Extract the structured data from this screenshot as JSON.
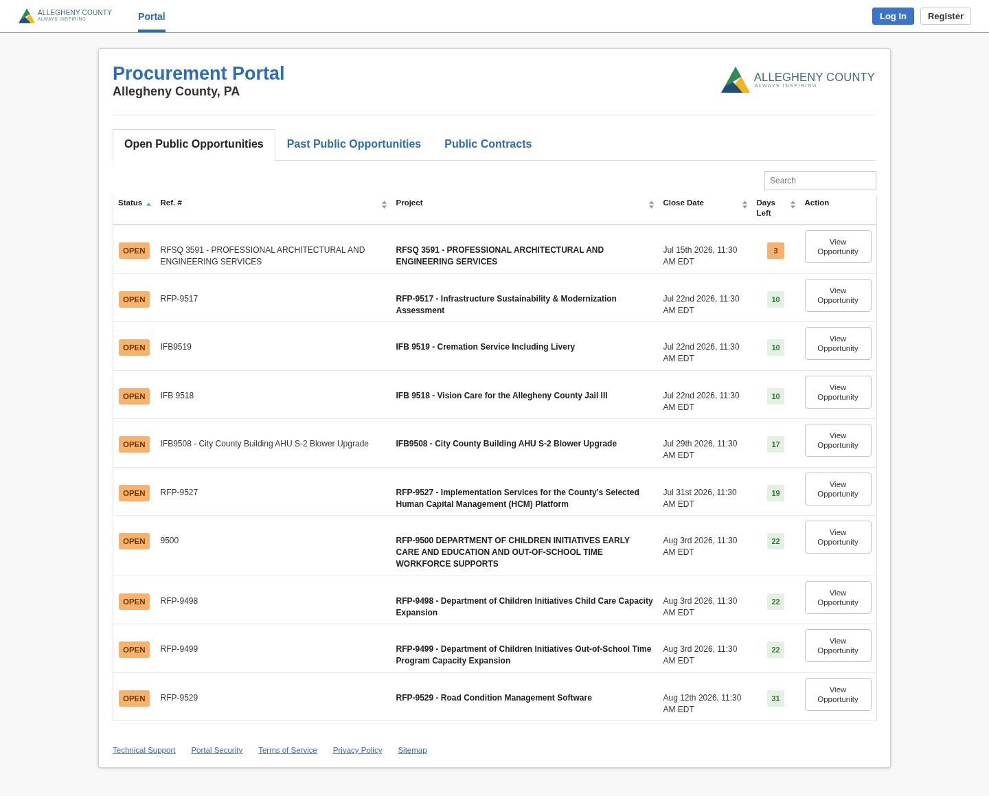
{
  "top_bar": {
    "logo": {
      "name": "ALLEGHENY COUNTY",
      "tagline": "ALWAYS INSPIRING"
    },
    "nav": [
      {
        "label": "Portal",
        "selected": true
      }
    ],
    "buttons": [
      {
        "label": "Log In",
        "kind": "primary"
      },
      {
        "label": "Register",
        "kind": "secondary"
      }
    ]
  },
  "header": {
    "title": "Procurement Portal",
    "subtitle": "Allegheny County, PA",
    "logo": {
      "name": "ALLEGHENY COUNTY",
      "tagline": "ALWAYS INSPIRING"
    }
  },
  "tabs": [
    {
      "label": "Open Public Opportunities",
      "selected": true
    },
    {
      "label": "Past Public Opportunities",
      "selected": false
    },
    {
      "label": "Public Contracts",
      "selected": false
    }
  ],
  "search": {
    "placeholder": "Search"
  },
  "table": {
    "columns": [
      {
        "label": "Status",
        "sortable": true,
        "sorted": true
      },
      {
        "label": "Ref. #",
        "sortable": true,
        "sorted": false
      },
      {
        "label": "Project",
        "sortable": true,
        "sorted": false
      },
      {
        "label": "Close Date",
        "sortable": true,
        "sorted": false
      },
      {
        "label": "Days Left",
        "sortable": true,
        "sorted": false
      },
      {
        "label": "Action",
        "sortable": false,
        "sorted": false
      }
    ],
    "rows": [
      {
        "status": "OPEN",
        "ref": "RFSQ 3591 - PROFESSIONAL ARCHITECTURAL AND ENGINEERING SERVICES",
        "project": "RFSQ 3591 - PROFESSIONAL ARCHITECTURAL AND ENGINEERING SERVICES",
        "close_date": "Jul 15th 2026, 11:30 AM EDT",
        "days_left": {
          "text": "3",
          "kind": "warning"
        },
        "action": "View Opportunity"
      },
      {
        "status": "OPEN",
        "ref": "RFP-9517",
        "project": "RFP-9517 - Infrastructure Sustainability & Modernization Assessment",
        "close_date": "Jul 22nd 2026, 11:30 AM EDT",
        "days_left": {
          "text": "10",
          "kind": "normal"
        },
        "action": "View Opportunity"
      },
      {
        "status": "OPEN",
        "ref": "IFB9519",
        "project": "IFB 9519 - Cremation Service Including Livery",
        "close_date": "Jul 22nd 2026, 11:30 AM EDT",
        "days_left": {
          "text": "10",
          "kind": "normal"
        },
        "action": "View Opportunity"
      },
      {
        "status": "OPEN",
        "ref": "IFB 9518",
        "project": "IFB 9518 - Vision Care for the Allegheny County Jail III",
        "close_date": "Jul 22nd 2026, 11:30 AM EDT",
        "days_left": {
          "text": "10",
          "kind": "normal"
        },
        "action": "View Opportunity"
      },
      {
        "status": "OPEN",
        "ref": "IFB9508 - City County Building AHU S-2 Blower Upgrade",
        "project": "IFB9508 - City County Building AHU S-2 Blower Upgrade",
        "close_date": "Jul 29th 2026, 11:30 AM EDT",
        "days_left": {
          "text": "17",
          "kind": "normal"
        },
        "action": "View Opportunity"
      },
      {
        "status": "OPEN",
        "ref": "RFP-9527",
        "project": "RFP-9527 - Implementation Services for the County's Selected Human Capital Management (HCM) Platform",
        "close_date": "Jul 31st 2026, 11:30 AM EDT",
        "days_left": {
          "text": "19",
          "kind": "normal"
        },
        "action": "View Opportunity"
      },
      {
        "status": "OPEN",
        "ref": "9500",
        "project": "RFP-9500 DEPARTMENT OF CHILDREN INITIATIVES EARLY CARE AND EDUCATION AND OUT-OF-SCHOOL TIME WORKFORCE SUPPORTS",
        "close_date": "Aug 3rd 2026, 11:30 AM EDT",
        "days_left": {
          "text": "22",
          "kind": "normal"
        },
        "action": "View Opportunity"
      },
      {
        "status": "OPEN",
        "ref": "RFP-9498",
        "project": "RFP-9498 - Department of Children Initiatives Child Care Capacity Expansion",
        "close_date": "Aug 3rd 2026, 11:30 AM EDT",
        "days_left": {
          "text": "22",
          "kind": "normal"
        },
        "action": "View Opportunity"
      },
      {
        "status": "OPEN",
        "ref": "RFP-9499",
        "project": "RFP-9499 - Department of Children Initiatives Out-of-School Time Program Capacity Expansion",
        "close_date": "Aug 3rd 2026, 11:30 AM EDT",
        "days_left": {
          "text": "22",
          "kind": "normal"
        },
        "action": "View Opportunity"
      },
      {
        "status": "OPEN",
        "ref": "RFP-9529",
        "project": "RFP-9529 - Road Condition Management Software",
        "close_date": "Aug 12th 2026, 11:30 AM EDT",
        "days_left": {
          "text": "31",
          "kind": "normal"
        },
        "action": "View Opportunity"
      }
    ]
  },
  "footer_links": [
    "Technical Support",
    "Portal Security",
    "Terms of Service",
    "Privacy Policy",
    "Sitemap"
  ]
}
